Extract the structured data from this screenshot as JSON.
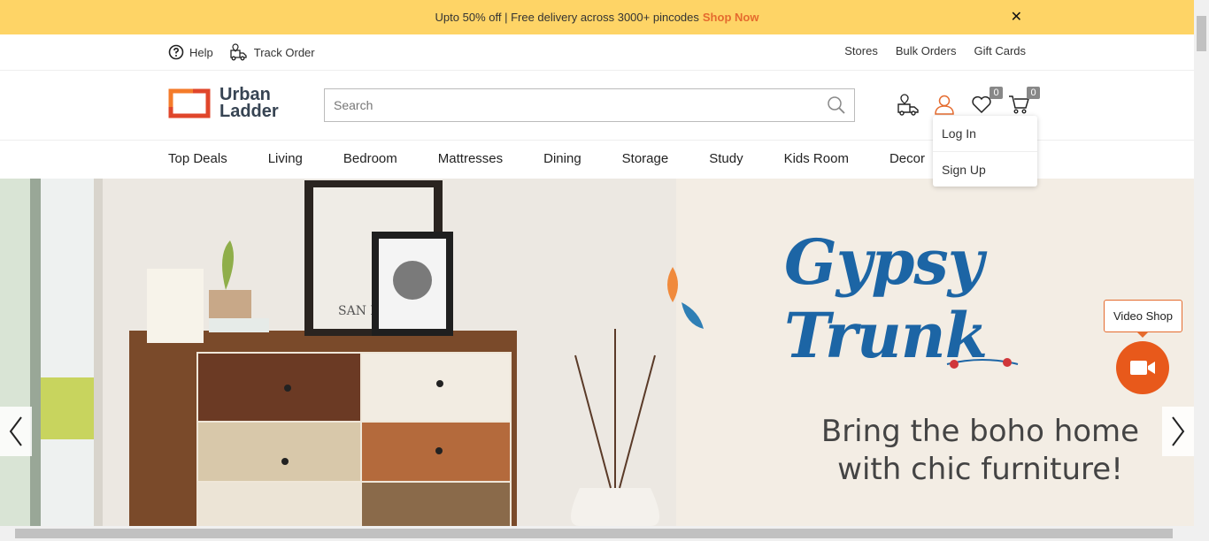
{
  "promo": {
    "text": "Upto 50% off | Free delivery across 3000+ pincodes",
    "link": "Shop Now",
    "close": "✕"
  },
  "utility": {
    "help": "Help",
    "track_order": "Track Order",
    "stores": "Stores",
    "bulk_orders": "Bulk Orders",
    "gift_cards": "Gift Cards"
  },
  "header": {
    "logo_line1": "Urban",
    "logo_line2": "Ladder",
    "search_placeholder": "Search",
    "wishlist_count": "0",
    "cart_count": "0"
  },
  "account_menu": {
    "login": "Log In",
    "signup": "Sign Up"
  },
  "nav": {
    "items": [
      "Top Deals",
      "Living",
      "Bedroom",
      "Mattresses",
      "Dining",
      "Storage",
      "Study",
      "Kids Room",
      "Decor"
    ]
  },
  "banner": {
    "title": "Gypsy Trunk",
    "line1": "Bring the boho home",
    "line2": "with chic furniture!",
    "art_text": "SAN FR"
  },
  "video_shop": {
    "label": "Video Shop"
  },
  "colors": {
    "promo_bg": "#fed466",
    "accent": "#e56b2e",
    "brand_text": "#374453",
    "banner_title": "#1c65a5"
  }
}
